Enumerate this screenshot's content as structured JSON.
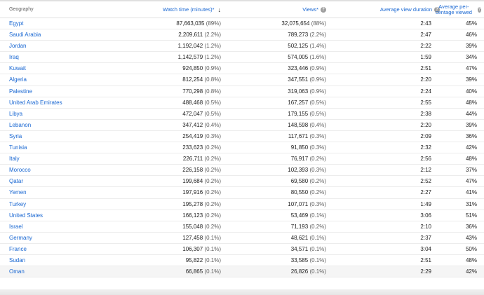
{
  "header": {
    "geography": "Geography",
    "watch_time": "Watch time (minutes)*",
    "views": "Views*",
    "avg_view_duration": "Average view duration",
    "avg_pct_viewed": "Average per-centage viewed",
    "help_glyph": "?",
    "sort_glyph": "↓"
  },
  "rows": [
    {
      "geo": "Egypt",
      "watch": "87,663,035",
      "watch_pct": "(89%)",
      "views": "32,075,654",
      "views_pct": "(88%)",
      "avd": "2:43",
      "avp": "45%"
    },
    {
      "geo": "Saudi Arabia",
      "watch": "2,209,611",
      "watch_pct": "(2.2%)",
      "views": "789,273",
      "views_pct": "(2.2%)",
      "avd": "2:47",
      "avp": "46%"
    },
    {
      "geo": "Jordan",
      "watch": "1,192,042",
      "watch_pct": "(1.2%)",
      "views": "502,125",
      "views_pct": "(1.4%)",
      "avd": "2:22",
      "avp": "39%"
    },
    {
      "geo": "Iraq",
      "watch": "1,142,579",
      "watch_pct": "(1.2%)",
      "views": "574,005",
      "views_pct": "(1.6%)",
      "avd": "1:59",
      "avp": "34%"
    },
    {
      "geo": "Kuwait",
      "watch": "924,850",
      "watch_pct": "(0.9%)",
      "views": "323,446",
      "views_pct": "(0.9%)",
      "avd": "2:51",
      "avp": "47%"
    },
    {
      "geo": "Algeria",
      "watch": "812,254",
      "watch_pct": "(0.8%)",
      "views": "347,551",
      "views_pct": "(0.9%)",
      "avd": "2:20",
      "avp": "39%"
    },
    {
      "geo": "Palestine",
      "watch": "770,298",
      "watch_pct": "(0.8%)",
      "views": "319,063",
      "views_pct": "(0.9%)",
      "avd": "2:24",
      "avp": "40%"
    },
    {
      "geo": "United Arab Emirates",
      "watch": "488,468",
      "watch_pct": "(0.5%)",
      "views": "167,257",
      "views_pct": "(0.5%)",
      "avd": "2:55",
      "avp": "48%"
    },
    {
      "geo": "Libya",
      "watch": "472,047",
      "watch_pct": "(0.5%)",
      "views": "179,155",
      "views_pct": "(0.5%)",
      "avd": "2:38",
      "avp": "44%"
    },
    {
      "geo": "Lebanon",
      "watch": "347,412",
      "watch_pct": "(0.4%)",
      "views": "148,598",
      "views_pct": "(0.4%)",
      "avd": "2:20",
      "avp": "39%"
    },
    {
      "geo": "Syria",
      "watch": "254,419",
      "watch_pct": "(0.3%)",
      "views": "117,671",
      "views_pct": "(0.3%)",
      "avd": "2:09",
      "avp": "36%"
    },
    {
      "geo": "Tunisia",
      "watch": "233,623",
      "watch_pct": "(0.2%)",
      "views": "91,850",
      "views_pct": "(0.3%)",
      "avd": "2:32",
      "avp": "42%"
    },
    {
      "geo": "Italy",
      "watch": "226,711",
      "watch_pct": "(0.2%)",
      "views": "76,917",
      "views_pct": "(0.2%)",
      "avd": "2:56",
      "avp": "48%"
    },
    {
      "geo": "Morocco",
      "watch": "226,158",
      "watch_pct": "(0.2%)",
      "views": "102,393",
      "views_pct": "(0.3%)",
      "avd": "2:12",
      "avp": "37%"
    },
    {
      "geo": "Qatar",
      "watch": "199,684",
      "watch_pct": "(0.2%)",
      "views": "69,580",
      "views_pct": "(0.2%)",
      "avd": "2:52",
      "avp": "47%"
    },
    {
      "geo": "Yemen",
      "watch": "197,916",
      "watch_pct": "(0.2%)",
      "views": "80,550",
      "views_pct": "(0.2%)",
      "avd": "2:27",
      "avp": "41%"
    },
    {
      "geo": "Turkey",
      "watch": "195,278",
      "watch_pct": "(0.2%)",
      "views": "107,071",
      "views_pct": "(0.3%)",
      "avd": "1:49",
      "avp": "31%"
    },
    {
      "geo": "United States",
      "watch": "166,123",
      "watch_pct": "(0.2%)",
      "views": "53,469",
      "views_pct": "(0.1%)",
      "avd": "3:06",
      "avp": "51%"
    },
    {
      "geo": "Israel",
      "watch": "155,048",
      "watch_pct": "(0.2%)",
      "views": "71,193",
      "views_pct": "(0.2%)",
      "avd": "2:10",
      "avp": "36%"
    },
    {
      "geo": "Germany",
      "watch": "127,458",
      "watch_pct": "(0.1%)",
      "views": "48,621",
      "views_pct": "(0.1%)",
      "avd": "2:37",
      "avp": "43%"
    },
    {
      "geo": "France",
      "watch": "106,307",
      "watch_pct": "(0.1%)",
      "views": "34,571",
      "views_pct": "(0.1%)",
      "avd": "3:04",
      "avp": "50%"
    },
    {
      "geo": "Sudan",
      "watch": "95,822",
      "watch_pct": "(0.1%)",
      "views": "33,585",
      "views_pct": "(0.1%)",
      "avd": "2:51",
      "avp": "48%"
    },
    {
      "geo": "Oman",
      "watch": "66,865",
      "watch_pct": "(0.1%)",
      "views": "26,826",
      "views_pct": "(0.1%)",
      "avd": "2:29",
      "avp": "42%"
    }
  ]
}
